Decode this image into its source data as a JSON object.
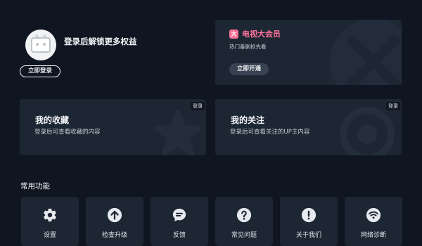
{
  "profile": {
    "prompt": "登录后解锁更多权益",
    "login_button": "立即登录"
  },
  "vip": {
    "logo_char": "大",
    "title": "电视大会员",
    "subtitle": "热门番剧抢先看",
    "button": "立即开通",
    "accent_color": "#fb7299"
  },
  "cards": [
    {
      "title": "我的收藏",
      "subtitle": "登录后可查看收藏的内容",
      "badge": "登录"
    },
    {
      "title": "我的关注",
      "subtitle": "登录后可查看关注的UP主内容",
      "badge": "登录"
    }
  ],
  "tools_section": {
    "title": "常用功能",
    "items": [
      {
        "label": "设置",
        "icon": "gear-icon"
      },
      {
        "label": "检查升级",
        "icon": "arrow-up-circle-icon"
      },
      {
        "label": "反馈",
        "icon": "chat-bubble-icon"
      },
      {
        "label": "常见问题",
        "icon": "question-circle-icon"
      },
      {
        "label": "关于我们",
        "icon": "exclamation-circle-icon"
      },
      {
        "label": "网络诊断",
        "icon": "wifi-icon"
      }
    ]
  },
  "colors": {
    "background": "#0f1621",
    "card": "#1d2633"
  }
}
